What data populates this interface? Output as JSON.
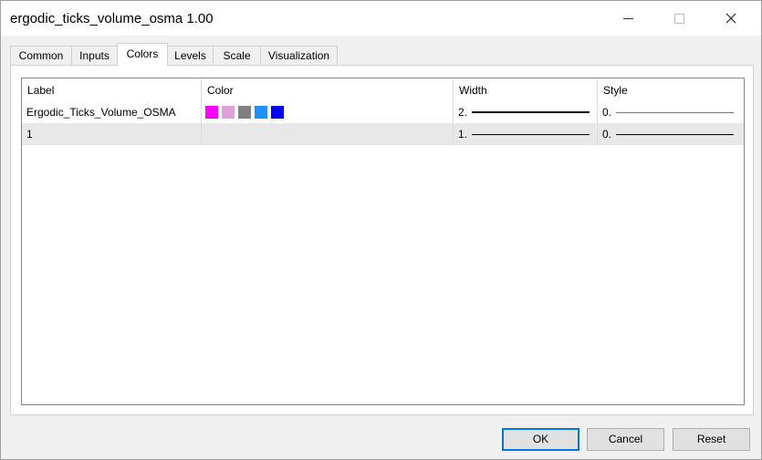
{
  "window": {
    "title": "ergodic_ticks_volume_osma 1.00"
  },
  "tabs": [
    {
      "label": "Common"
    },
    {
      "label": "Inputs"
    },
    {
      "label": "Colors"
    },
    {
      "label": "Levels"
    },
    {
      "label": "Scale"
    },
    {
      "label": "Visualization"
    }
  ],
  "active_tab": "Colors",
  "table": {
    "columns": [
      "Label",
      "Color",
      "Width",
      "Style"
    ],
    "rows": [
      {
        "label": "Ergodic_Ticks_Volume_OSMA",
        "colors": [
          "#ff00ff",
          "#dda0dd",
          "#808080",
          "#1e90ff",
          "#0000ff"
        ],
        "width": "2.",
        "style": "0."
      },
      {
        "label": "1",
        "colors": [],
        "width": "1.",
        "style": "0."
      }
    ]
  },
  "buttons": {
    "ok": "OK",
    "cancel": "Cancel",
    "reset": "Reset"
  }
}
